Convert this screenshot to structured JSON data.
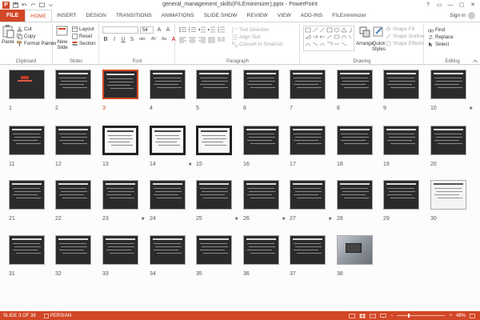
{
  "window": {
    "title": "general_management_skills(FILEminimizer).pptx - PowerPoint",
    "controls": [
      "?",
      "▭",
      "—",
      "▢",
      "✕"
    ]
  },
  "ribbon_tabs": {
    "file": "FILE",
    "tabs": [
      "HOME",
      "INSERT",
      "DESIGN",
      "TRANSITIONS",
      "ANIMATIONS",
      "SLIDE SHOW",
      "REVIEW",
      "VIEW",
      "ADD-INS",
      "FILEminimizer"
    ],
    "active": "HOME",
    "signin": "Sign in"
  },
  "clipboard": {
    "paste": "Paste",
    "cut": "Cut",
    "copy": "Copy",
    "format_painter": "Format Painter",
    "label": "Clipboard"
  },
  "slides_group": {
    "new_slide": "New",
    "new_slide_2": "Slide",
    "layout": "Layout",
    "reset": "Reset",
    "section": "Section",
    "label": "Slides"
  },
  "font_group": {
    "font_size": "54",
    "label": "Font",
    "buttons": [
      "B",
      "I",
      "U",
      "S",
      "abc",
      "AV",
      "Aa",
      "A"
    ]
  },
  "paragraph_group": {
    "text_direction": "Text Direction",
    "align_text": "Align Text",
    "convert_smartart": "Convert to SmartArt",
    "label": "Paragraph"
  },
  "drawing_group": {
    "arrange": "Arrange",
    "quick_styles": "Quick",
    "quick_styles_2": "Styles",
    "shape_fill": "Shape Fill",
    "shape_outline": "Shape Outline",
    "shape_effects": "Shape Effects",
    "label": "Drawing"
  },
  "editing_group": {
    "find": "Find",
    "replace": "Replace",
    "select": "Select",
    "label": "Editing"
  },
  "slides": {
    "numbers": [
      "1",
      "2",
      "3",
      "4",
      "5",
      "6",
      "7",
      "8",
      "9",
      "10",
      "11",
      "12",
      "13",
      "14",
      "15",
      "16",
      "17",
      "18",
      "19",
      "20",
      "21",
      "22",
      "23",
      "24",
      "25",
      "26",
      "27",
      "28",
      "29",
      "30",
      "31",
      "32",
      "33",
      "34",
      "35",
      "36",
      "37",
      "38"
    ],
    "selected": "3",
    "star_mark": "★"
  },
  "statusbar": {
    "slide_info": "SLIDE 3 OF 38",
    "language": "PERSIAN",
    "zoom": "48%",
    "zoom_level": 0.48
  },
  "colors": {
    "accent": "#d24726",
    "slide_bg": "#2b2b2b"
  }
}
